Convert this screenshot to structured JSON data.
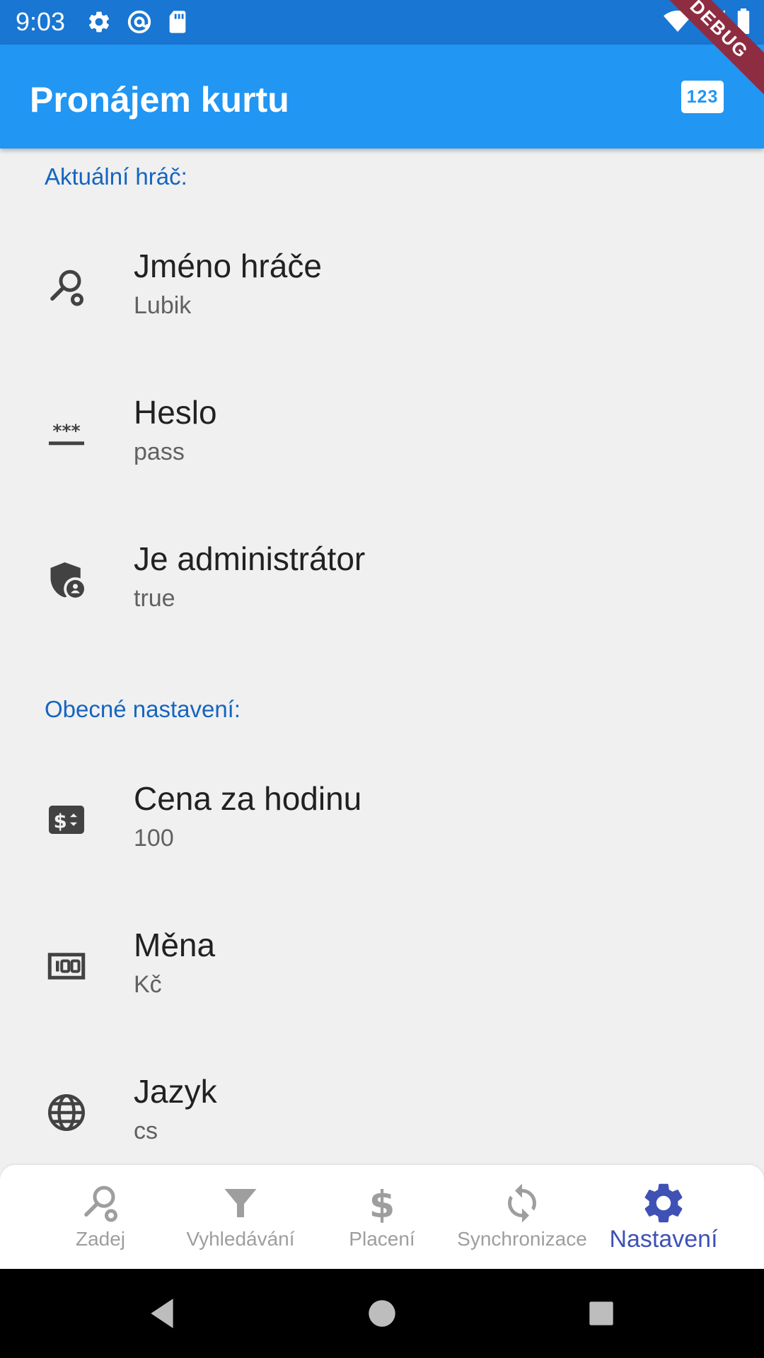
{
  "status_bar": {
    "time": "9:03",
    "left_icons": [
      "settings-icon",
      "at-sign-icon",
      "sd-card-icon"
    ],
    "right_icons": [
      "wifi-icon",
      "signal-icon",
      "battery-icon"
    ]
  },
  "debug_banner": "DEBUG",
  "app_bar": {
    "title": "Pronájem kurtu",
    "action_label": "123"
  },
  "sections": [
    {
      "header": "Aktuální hráč:",
      "items": [
        {
          "icon": "racket-icon",
          "title": "Jméno hráče",
          "value": "Lubik"
        },
        {
          "icon": "password-icon",
          "title": "Heslo",
          "value": "pass"
        },
        {
          "icon": "admin-shield-icon",
          "title": "Je administrátor",
          "value": "true"
        }
      ]
    },
    {
      "header": "Obecné nastavení:",
      "items": [
        {
          "icon": "price-change-icon",
          "title": "Cena za hodinu",
          "value": "100"
        },
        {
          "icon": "money-bill-icon",
          "title": "Měna",
          "value": "Kč"
        },
        {
          "icon": "globe-icon",
          "title": "Jazyk",
          "value": "cs"
        }
      ]
    }
  ],
  "bottom_nav": {
    "items": [
      {
        "label": "Zadej",
        "icon": "racket-icon"
      },
      {
        "label": "Vyhledávání",
        "icon": "filter-icon"
      },
      {
        "label": "Placení",
        "icon": "dollar-icon"
      },
      {
        "label": "Synchronizace",
        "icon": "sync-icon"
      },
      {
        "label": "Nastavení",
        "icon": "gear-icon",
        "active": true
      }
    ]
  },
  "colors": {
    "status_bar": "#1976d2",
    "app_bar": "#2196f3",
    "section_header": "#1565c0",
    "nav_active": "#3f51b5",
    "nav_inactive": "#9e9e9e",
    "background": "#f0f0f0"
  }
}
